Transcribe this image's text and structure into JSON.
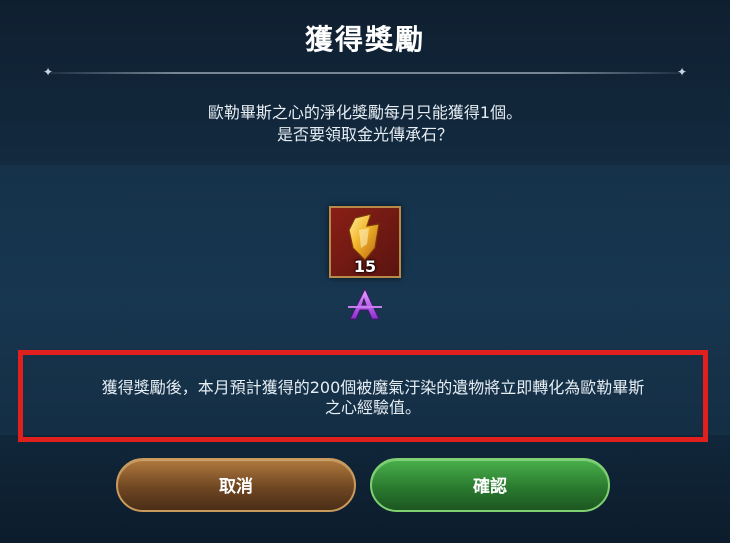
{
  "dialog": {
    "title": "獲得獎勵",
    "message_line1": "歐勒畢斯之心的淨化獎勵每月只能獲得1個。",
    "message_line2": "是否要領取金光傳承石？",
    "reward": {
      "icon": "golden-stone-icon",
      "count": "15",
      "grade_icon": "grade-a-icon"
    },
    "notice_line1": "獲得獎勵後，本月預計獲得的200個被魔氣汙染的遺物將立即轉化為歐勒畢斯",
    "notice_line2": "之心經驗值。",
    "cancel_label": "取消",
    "confirm_label": "確認"
  },
  "colors": {
    "highlight_border": "#e0201c",
    "cancel_button": "#6f4622",
    "confirm_button": "#2a7a2f"
  }
}
